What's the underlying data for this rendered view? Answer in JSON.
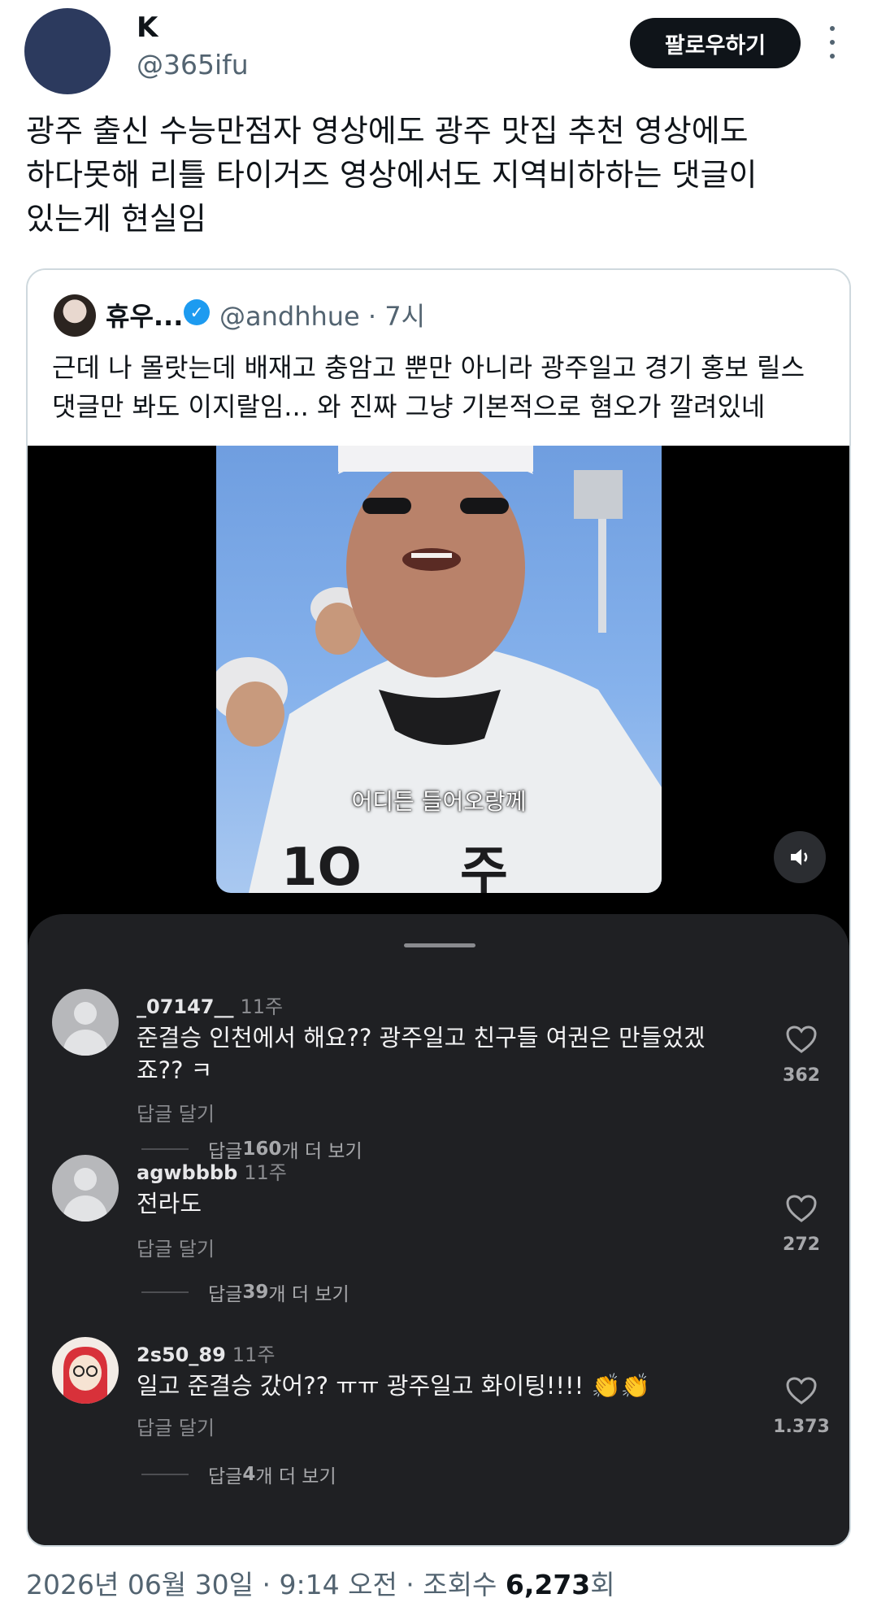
{
  "author": {
    "name": "K",
    "handle": "@365ifu",
    "follow_label": "팔로우하기"
  },
  "tweet": {
    "lines": [
      "광주 출신 수능만점자 영상에도 광주 맛집 추천 영상에도",
      "하다못해 리틀 타이거즈 영상에서도 지역비하하는 댓글이",
      "있는게 현실임"
    ]
  },
  "quote": {
    "name": "휴우...",
    "handle": "@andhhue",
    "time": "· 7시",
    "lines": [
      "근데 나 몰랏는데 배재고 충암고 뿐만 아니라 광주일고 경기 홍보 릴스",
      "댓글만 봐도 이지랄임... 와 진짜 그냥 기본적으로 혐오가 깔려있네"
    ],
    "video_subtitle": "어디든 들어오랑께"
  },
  "comments": [
    {
      "user": "_07147__",
      "time": "11주",
      "text_lines": [
        "준결승 인천에서 해요?? 광주일고 친구들 여권은 만들었겠",
        "죠?? ㅋ"
      ],
      "reply_label": "답글 달기",
      "more_prefix": "답글 ",
      "more_count": "160",
      "more_suffix": "개 더 보기",
      "likes": "362"
    },
    {
      "user": "agwbbbb",
      "time": "11주",
      "text_lines": [
        "전라도"
      ],
      "reply_label": "답글 달기",
      "more_prefix": "답글 ",
      "more_count": "39",
      "more_suffix": "개 더 보기",
      "likes": "272"
    },
    {
      "user": "2s50_89",
      "time": "11주",
      "text_lines": [
        "일고 준결승 갔어?? ㅠㅠ 광주일고 화이팅!!!! 👏👏"
      ],
      "reply_label": "답글 달기",
      "more_prefix": "답글 ",
      "more_count": "4",
      "more_suffix": "개 더 보기",
      "likes": "1.373"
    }
  ],
  "footer": {
    "date": "2026년 06월 30일 · 9:14 오전 · 조회수 ",
    "views": "6,273",
    "views_suffix": "회"
  },
  "colors": {
    "brand_dark": "#0f1419",
    "secondary_text": "#536471",
    "verified": "#1d9bf0",
    "comments_bg": "#1f2023"
  }
}
